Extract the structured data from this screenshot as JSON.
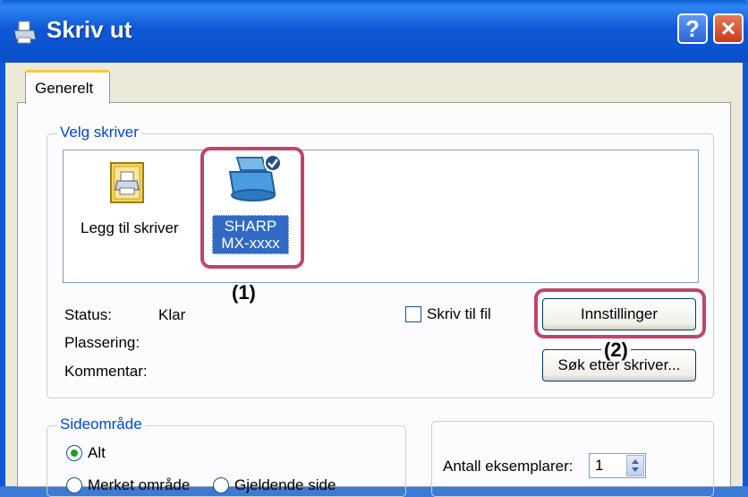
{
  "window": {
    "title": "Skriv ut",
    "help_label": "?",
    "close_label": "×"
  },
  "tabs": [
    {
      "label": "Generelt"
    }
  ],
  "printer_group": {
    "legend": "Velg skriver",
    "printers": [
      {
        "label": "Legg til skriver",
        "icon": "add-printer-icon"
      },
      {
        "label_line1": "SHARP",
        "label_line2": "MX-xxxx",
        "icon": "printer-icon",
        "selected": true
      }
    ]
  },
  "status": {
    "status_label": "Status:",
    "status_value": "Klar",
    "location_label": "Plassering:",
    "comment_label": "Kommentar:"
  },
  "print_to_file": {
    "label": "Skriv til fil",
    "checked": false
  },
  "buttons": {
    "settings": "Innstillinger",
    "find_printer": "Søk etter skriver..."
  },
  "callouts": {
    "one": "(1)",
    "two": "(2)"
  },
  "page_range": {
    "legend": "Sideområde",
    "options": [
      {
        "label": "Alt",
        "selected": true
      },
      {
        "label": "Merket område"
      },
      {
        "label": "Gjeldende side"
      }
    ]
  },
  "copies": {
    "label": "Antall eksemplarer:",
    "value": "1"
  },
  "colors": {
    "accent": "#0046d5",
    "callout": "#c2446a",
    "titlebar": "#0a4fc8",
    "selection": "#316ac5"
  }
}
